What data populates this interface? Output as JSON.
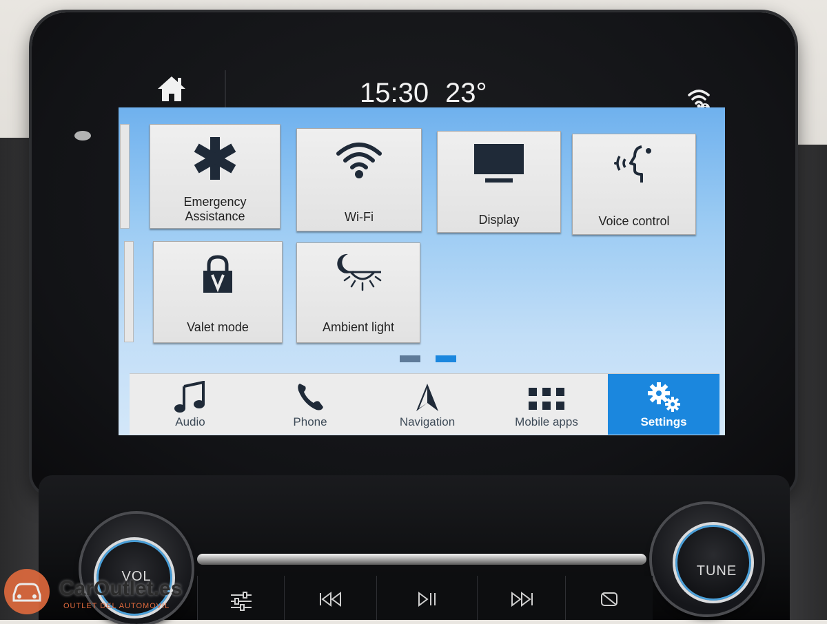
{
  "status_bar": {
    "time": "15:30",
    "temperature": "23°",
    "icons": [
      "home-icon",
      "wifi-info-icon"
    ]
  },
  "settings_tiles": [
    {
      "label_line1": "Emergency",
      "label_line2": "Assistance",
      "icon": "asterisk-icon"
    },
    {
      "label": "Wi-Fi",
      "icon": "wifi-icon"
    },
    {
      "label": "Display",
      "icon": "monitor-icon"
    },
    {
      "label": "Voice control",
      "icon": "voice-icon"
    },
    {
      "label": "Valet mode",
      "icon": "lock-icon"
    },
    {
      "label": "Ambient light",
      "icon": "ambient-light-icon"
    }
  ],
  "pager": {
    "pages": 2,
    "current_page": 2
  },
  "nav_bar": {
    "items": [
      {
        "label": "Audio",
        "icon": "music-note-icon"
      },
      {
        "label": "Phone",
        "icon": "phone-icon"
      },
      {
        "label": "Navigation",
        "icon": "navigation-arrow-icon"
      },
      {
        "label": "Mobile apps",
        "icon": "grid-icon"
      },
      {
        "label": "Settings",
        "icon": "gears-icon",
        "active": true
      }
    ]
  },
  "hardware": {
    "left_knob": "VOL",
    "right_knob": "TUNE",
    "buttons": [
      "equalizer-icon",
      "skip-back-icon",
      "play-pause-icon",
      "skip-forward-icon",
      "screen-off-icon"
    ]
  },
  "watermark": {
    "brand": "CarOutlet.es",
    "tagline": "OUTLET DEL AUTOMOVIL"
  },
  "colors": {
    "accent": "#1b87de",
    "screen_top": "#6fb1ee",
    "screen_bottom": "#d3e7f9",
    "tile_bg": "#e8e8e8",
    "icon_dark": "#1f2a38",
    "watermark_orange": "#e06a3d"
  }
}
